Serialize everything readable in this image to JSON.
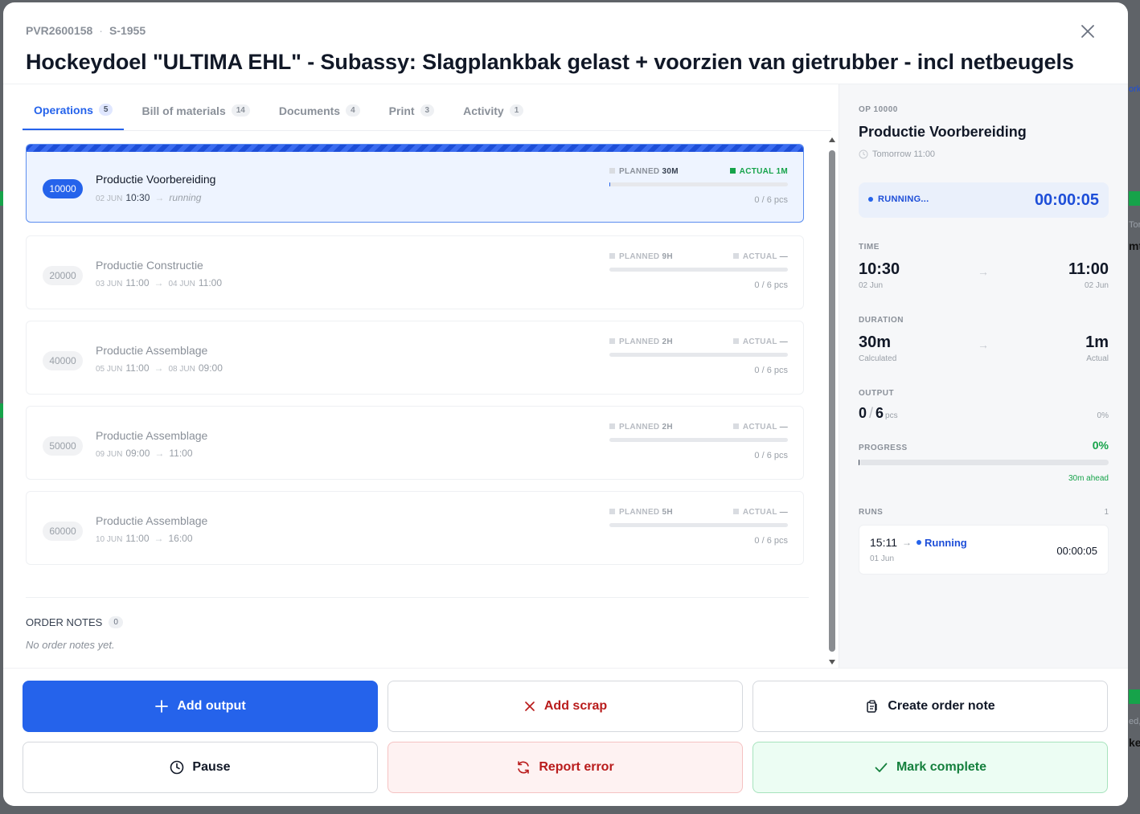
{
  "background": {
    "hints": [
      "ork",
      "Tor",
      "mt",
      "ed,",
      "ke"
    ]
  },
  "header": {
    "order_code": "PVR2600158",
    "separator": "·",
    "sales_code": "S-1955",
    "title": "Hockeydoel \"ULTIMA EHL\" - Subassy: Slagplankbak gelast + voorzien van gietrubber - incl netbeugels",
    "close_icon": "close-icon"
  },
  "tabs": [
    {
      "label": "Operations",
      "count": "5",
      "active": true
    },
    {
      "label": "Bill of materials",
      "count": "14",
      "active": false
    },
    {
      "label": "Documents",
      "count": "4",
      "active": false
    },
    {
      "label": "Print",
      "count": "3",
      "active": false
    },
    {
      "label": "Activity",
      "count": "1",
      "active": false
    }
  ],
  "operations": [
    {
      "number": "10000",
      "name": "Productie Voorbereiding",
      "start_date": "02 JUN",
      "start_time": "10:30",
      "arrow": "→",
      "end_date": "",
      "end_time": "",
      "status": "running",
      "planned_label": "PLANNED",
      "planned_value": "30M",
      "actual_label": "ACTUAL",
      "actual_value": "1M",
      "progress": 0.003,
      "pcs": "0 / 6 pcs",
      "active": true
    },
    {
      "number": "20000",
      "name": "Productie Constructie",
      "start_date": "03 JUN",
      "start_time": "11:00",
      "arrow": "→",
      "end_date": "04 JUN",
      "end_time": "11:00",
      "status": "",
      "planned_label": "PLANNED",
      "planned_value": "9H",
      "actual_label": "ACTUAL",
      "actual_value": "—",
      "progress": 0,
      "pcs": "0 / 6 pcs",
      "active": false
    },
    {
      "number": "40000",
      "name": "Productie Assemblage",
      "start_date": "05 JUN",
      "start_time": "11:00",
      "arrow": "→",
      "end_date": "08 JUN",
      "end_time": "09:00",
      "status": "",
      "planned_label": "PLANNED",
      "planned_value": "2H",
      "actual_label": "ACTUAL",
      "actual_value": "—",
      "progress": 0,
      "pcs": "0 / 6 pcs",
      "active": false
    },
    {
      "number": "50000",
      "name": "Productie Assemblage",
      "start_date": "09 JUN",
      "start_time": "09:00",
      "arrow": "→",
      "end_date": "",
      "end_time": "11:00",
      "status": "",
      "planned_label": "PLANNED",
      "planned_value": "2H",
      "actual_label": "ACTUAL",
      "actual_value": "—",
      "progress": 0,
      "pcs": "0 / 6 pcs",
      "active": false
    },
    {
      "number": "60000",
      "name": "Productie Assemblage",
      "start_date": "10 JUN",
      "start_time": "11:00",
      "arrow": "→",
      "end_date": "",
      "end_time": "16:00",
      "status": "",
      "planned_label": "PLANNED",
      "planned_value": "5H",
      "actual_label": "ACTUAL",
      "actual_value": "—",
      "progress": 0,
      "pcs": "0 / 6 pcs",
      "active": false
    }
  ],
  "notes": {
    "heading": "ORDER NOTES",
    "count": "0",
    "empty": "No order notes yet."
  },
  "detail": {
    "op_label": "OP 10000",
    "op_name": "Productie Voorbereiding",
    "when": "Tomorrow 11:00",
    "running_label": "RUNNING...",
    "timer": "00:00:05",
    "time_label": "TIME",
    "time_start": "10:30",
    "time_start_sub": "02 Jun",
    "time_end": "11:00",
    "time_end_sub": "02 Jun",
    "arrow": "→",
    "duration_label": "DURATION",
    "duration_calc": "30m",
    "duration_calc_sub": "Calculated",
    "duration_actual": "1m",
    "duration_actual_sub": "Actual",
    "output_label": "OUTPUT",
    "output_done": "0",
    "output_slash": "/",
    "output_total": "6",
    "output_unit": "pcs",
    "output_pct": "0%",
    "progress_label": "PROGRESS",
    "progress_pct": "0%",
    "progress_value": 0.003,
    "ahead": "30m ahead",
    "runs_label": "RUNS",
    "runs_count": "1",
    "run": {
      "start": "15:11",
      "arrow": "→",
      "status": "Running",
      "date": "01 Jun",
      "elapsed": "00:00:05"
    }
  },
  "actions": {
    "add_output": "Add output",
    "add_scrap": "Add scrap",
    "create_note": "Create order note",
    "pause": "Pause",
    "report_error": "Report error",
    "mark_complete": "Mark complete"
  },
  "colors": {
    "primary": "#2563eb",
    "success": "#16a34a",
    "danger": "#b91c1c"
  }
}
